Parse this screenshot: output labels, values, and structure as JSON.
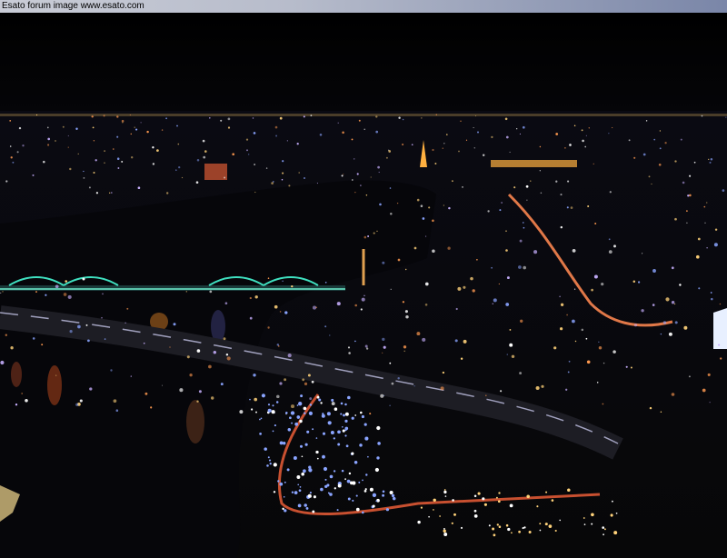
{
  "watermark": {
    "text": "Esato forum image www.esato.com"
  },
  "photo": {
    "subject": "night city skyline with river and bridges",
    "colors": {
      "sky": "#020205",
      "river": "#07070c",
      "bridge_lights": "#3fe0c0",
      "city_lights": "#ffd27a",
      "blue_lights": "#8aa4ff"
    }
  }
}
